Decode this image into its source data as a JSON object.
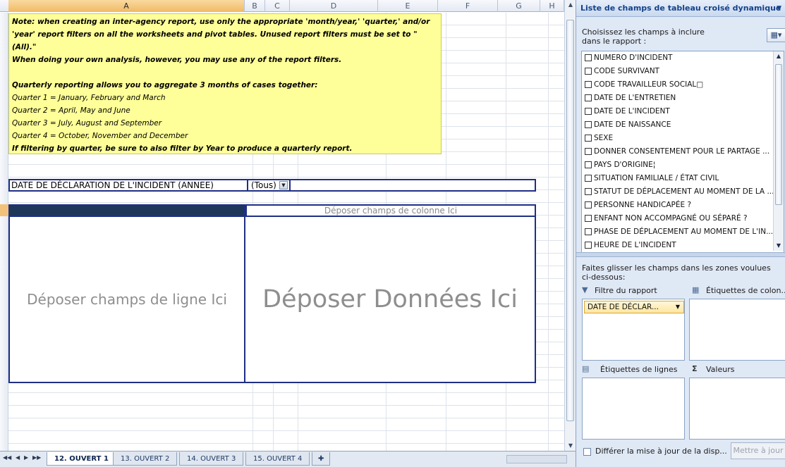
{
  "sheet": {
    "columns": [
      "A",
      "B",
      "C",
      "D",
      "E",
      "F",
      "G",
      "H"
    ],
    "selected_column": "A",
    "note": {
      "line1": "Note: when creating an inter-agency report, use only the appropriate 'month/year,' 'quarter,' and/or",
      "line2": "'year' report filters on all the worksheets and pivot tables.  Unused report filters must be set to \"(All).\"",
      "line3": "When doing your own analysis, however, you may use any of the report filters.",
      "line4": "Quarterly reporting allows you to aggregate 3 months of cases together:",
      "line5": "Quarter 1 = January, February and March",
      "line6": "Quarter 2 = April, May and June",
      "line7": "Quarter 3 = July, August and September",
      "line8": "Quarter 4 = October, November and December",
      "line9": "If filtering by quarter, be sure to also filter by Year to produce a quarterly report."
    },
    "pivot": {
      "filter_label": "DATE DE DÉCLARATION DE L'INCIDENT (ANNEE)",
      "filter_value": "(Tous)",
      "column_drop": "Déposer champs de colonne Ici",
      "row_drop": "Déposer champs de ligne Ici",
      "data_drop": "Déposer Données Ici"
    },
    "tabs": [
      "12. OUVERT 1",
      "13. OUVERT 2",
      "14. OUVERT 3",
      "15. OUVERT 4"
    ],
    "active_tab": "12. OUVERT 1"
  },
  "panel": {
    "title": "Liste de champs de tableau croisé dynamique",
    "choose_text": "Choisissez les champs à inclure dans le rapport :",
    "fields": [
      "NUMERO D'INCIDENT",
      "CODE SURVIVANT",
      "CODE TRAVAILLEUR SOCIAL□",
      "DATE DE L'ENTRETIEN",
      "DATE DE L'INCIDENT",
      "DATE DE NAISSANCE",
      "SEXE",
      "DONNER CONSENTEMENT POUR LE PARTAGE ...",
      "PAYS D'ORIGINE¦",
      "SITUATION FAMILIALE / ÉTAT CIVIL",
      "STATUT DE DÉPLACEMENT AU MOMENT DE LA ...",
      "PERSONNE HANDICAPÉE ?",
      "ENFANT NON ACCOMPAGNÉ OU SÉPARÉ ?",
      "PHASE DE DÉPLACEMENT AU MOMENT DE L'IN...",
      "HEURE DE L'INCIDENT"
    ],
    "drag_text": "Faites glisser les champs dans les zones voulues ci-dessous:",
    "areas": {
      "report_filter": "Filtre du rapport",
      "column_labels": "Étiquettes de colon...",
      "row_labels": "Étiquettes de lignes",
      "values": "Valeurs"
    },
    "filter_chip": "DATE DE DÉCLAR...",
    "defer_label": "Différer la mise à jour de la disp...",
    "update_button": "Mettre à jour"
  }
}
